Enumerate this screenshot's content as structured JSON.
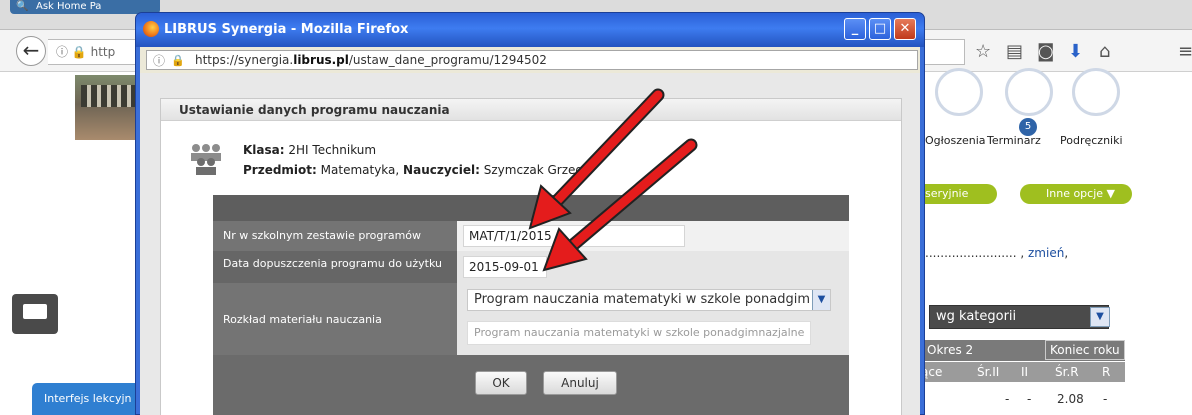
{
  "background_window": {
    "tab_label": "Ask Home Pa",
    "url_partial": "http",
    "nav_items": [
      "Ogłoszenia",
      "Terminarz",
      "Podręczniki"
    ],
    "terminarz_badge": "5",
    "green_buttons": [
      "seryjnie",
      "Inne opcje ▼"
    ],
    "zmien_dots": "........................",
    "zmien_link": "zmień",
    "category_select": "wg kategorii",
    "table_header1": [
      "Okres 2",
      "Koniec roku"
    ],
    "table_header2": [
      "ące",
      "Śr.II",
      "II",
      "Śr.R",
      "R"
    ],
    "table_row": [
      "-",
      "-",
      "2.08",
      "-"
    ],
    "left_tab_label": "Interfejs lekcyjn"
  },
  "popup": {
    "title": "LIBRUS Synergia - Mozilla Firefox",
    "url_prefix": "https://synergia.",
    "url_domain": "librus.pl",
    "url_path": "/ustaw_dane_programu/1294502",
    "dialog_title": "Ustawianie danych programu nauczania",
    "klasa_label": "Klasa:",
    "klasa_value": "2HI Technikum",
    "przedmiot_label": "Przedmiot:",
    "przedmiot_value": "Matematyka,",
    "nauczyciel_label": "Nauczyciel:",
    "nauczyciel_value": "Szymczak Grzeg",
    "form": {
      "nr_label": "Nr w szkolnym zestawie programów",
      "nr_value": "MAT/T/1/2015",
      "data_label": "Data dopuszczenia programu do użytku",
      "data_value": "2015-09-01",
      "rozklad_label": "Rozkład materiału nauczania",
      "rozklad_select": "Program nauczania matematyki w szkole ponadgim",
      "rozklad_text": "Program nauczania matematyki w szkole ponadgimnazjalne",
      "ok_label": "OK",
      "cancel_label": "Anuluj"
    }
  }
}
